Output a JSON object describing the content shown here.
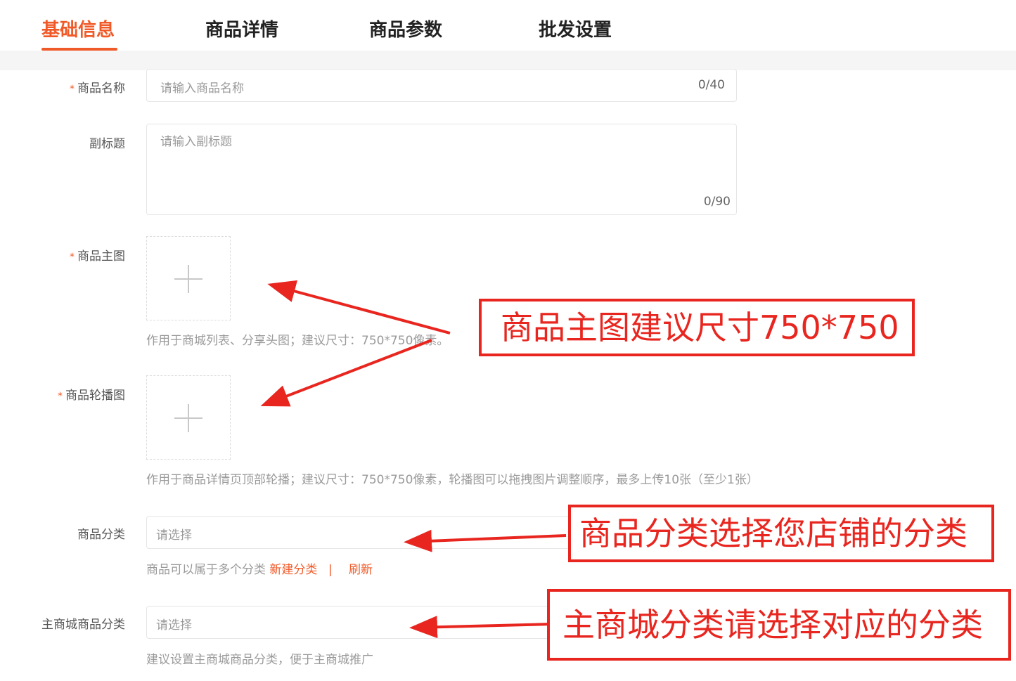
{
  "tabs": [
    {
      "label": "基础信息",
      "active": true
    },
    {
      "label": "商品详情",
      "active": false
    },
    {
      "label": "商品参数",
      "active": false
    },
    {
      "label": "批发设置",
      "active": false
    }
  ],
  "required_mark": "*",
  "form": {
    "name": {
      "label": "商品名称",
      "placeholder": "请输入商品名称",
      "counter": "0/40"
    },
    "subtitle": {
      "label": "副标题",
      "placeholder": "请输入副标题",
      "counter": "0/90"
    },
    "main_image": {
      "label": "商品主图",
      "hint": "作用于商城列表、分享头图；建议尺寸：750*750像素。"
    },
    "carousel": {
      "label": "商品轮播图",
      "hint": "作用于商品详情页顶部轮播；建议尺寸：750*750像素，轮播图可以拖拽图片调整顺序，最多上传10张（至少1张）"
    },
    "category": {
      "label": "商品分类",
      "placeholder": "请选择",
      "hint": "商品可以属于多个分类",
      "new_link": "新建分类",
      "separator": "|",
      "refresh_link": "刷新"
    },
    "mall_category": {
      "label": "主商城商品分类",
      "placeholder": "请选择",
      "hint": "建议设置主商城商品分类，便于主商城推广"
    }
  },
  "annotations": {
    "main_image_size": "商品主图建议尺寸750*750",
    "category_note": "商品分类选择您店铺的分类",
    "mall_category_note": "主商城分类请选择对应的分类"
  },
  "colors": {
    "accent": "#f05a28",
    "annotation_red": "#e8261f"
  },
  "icons": {
    "upload": "plus-icon"
  }
}
